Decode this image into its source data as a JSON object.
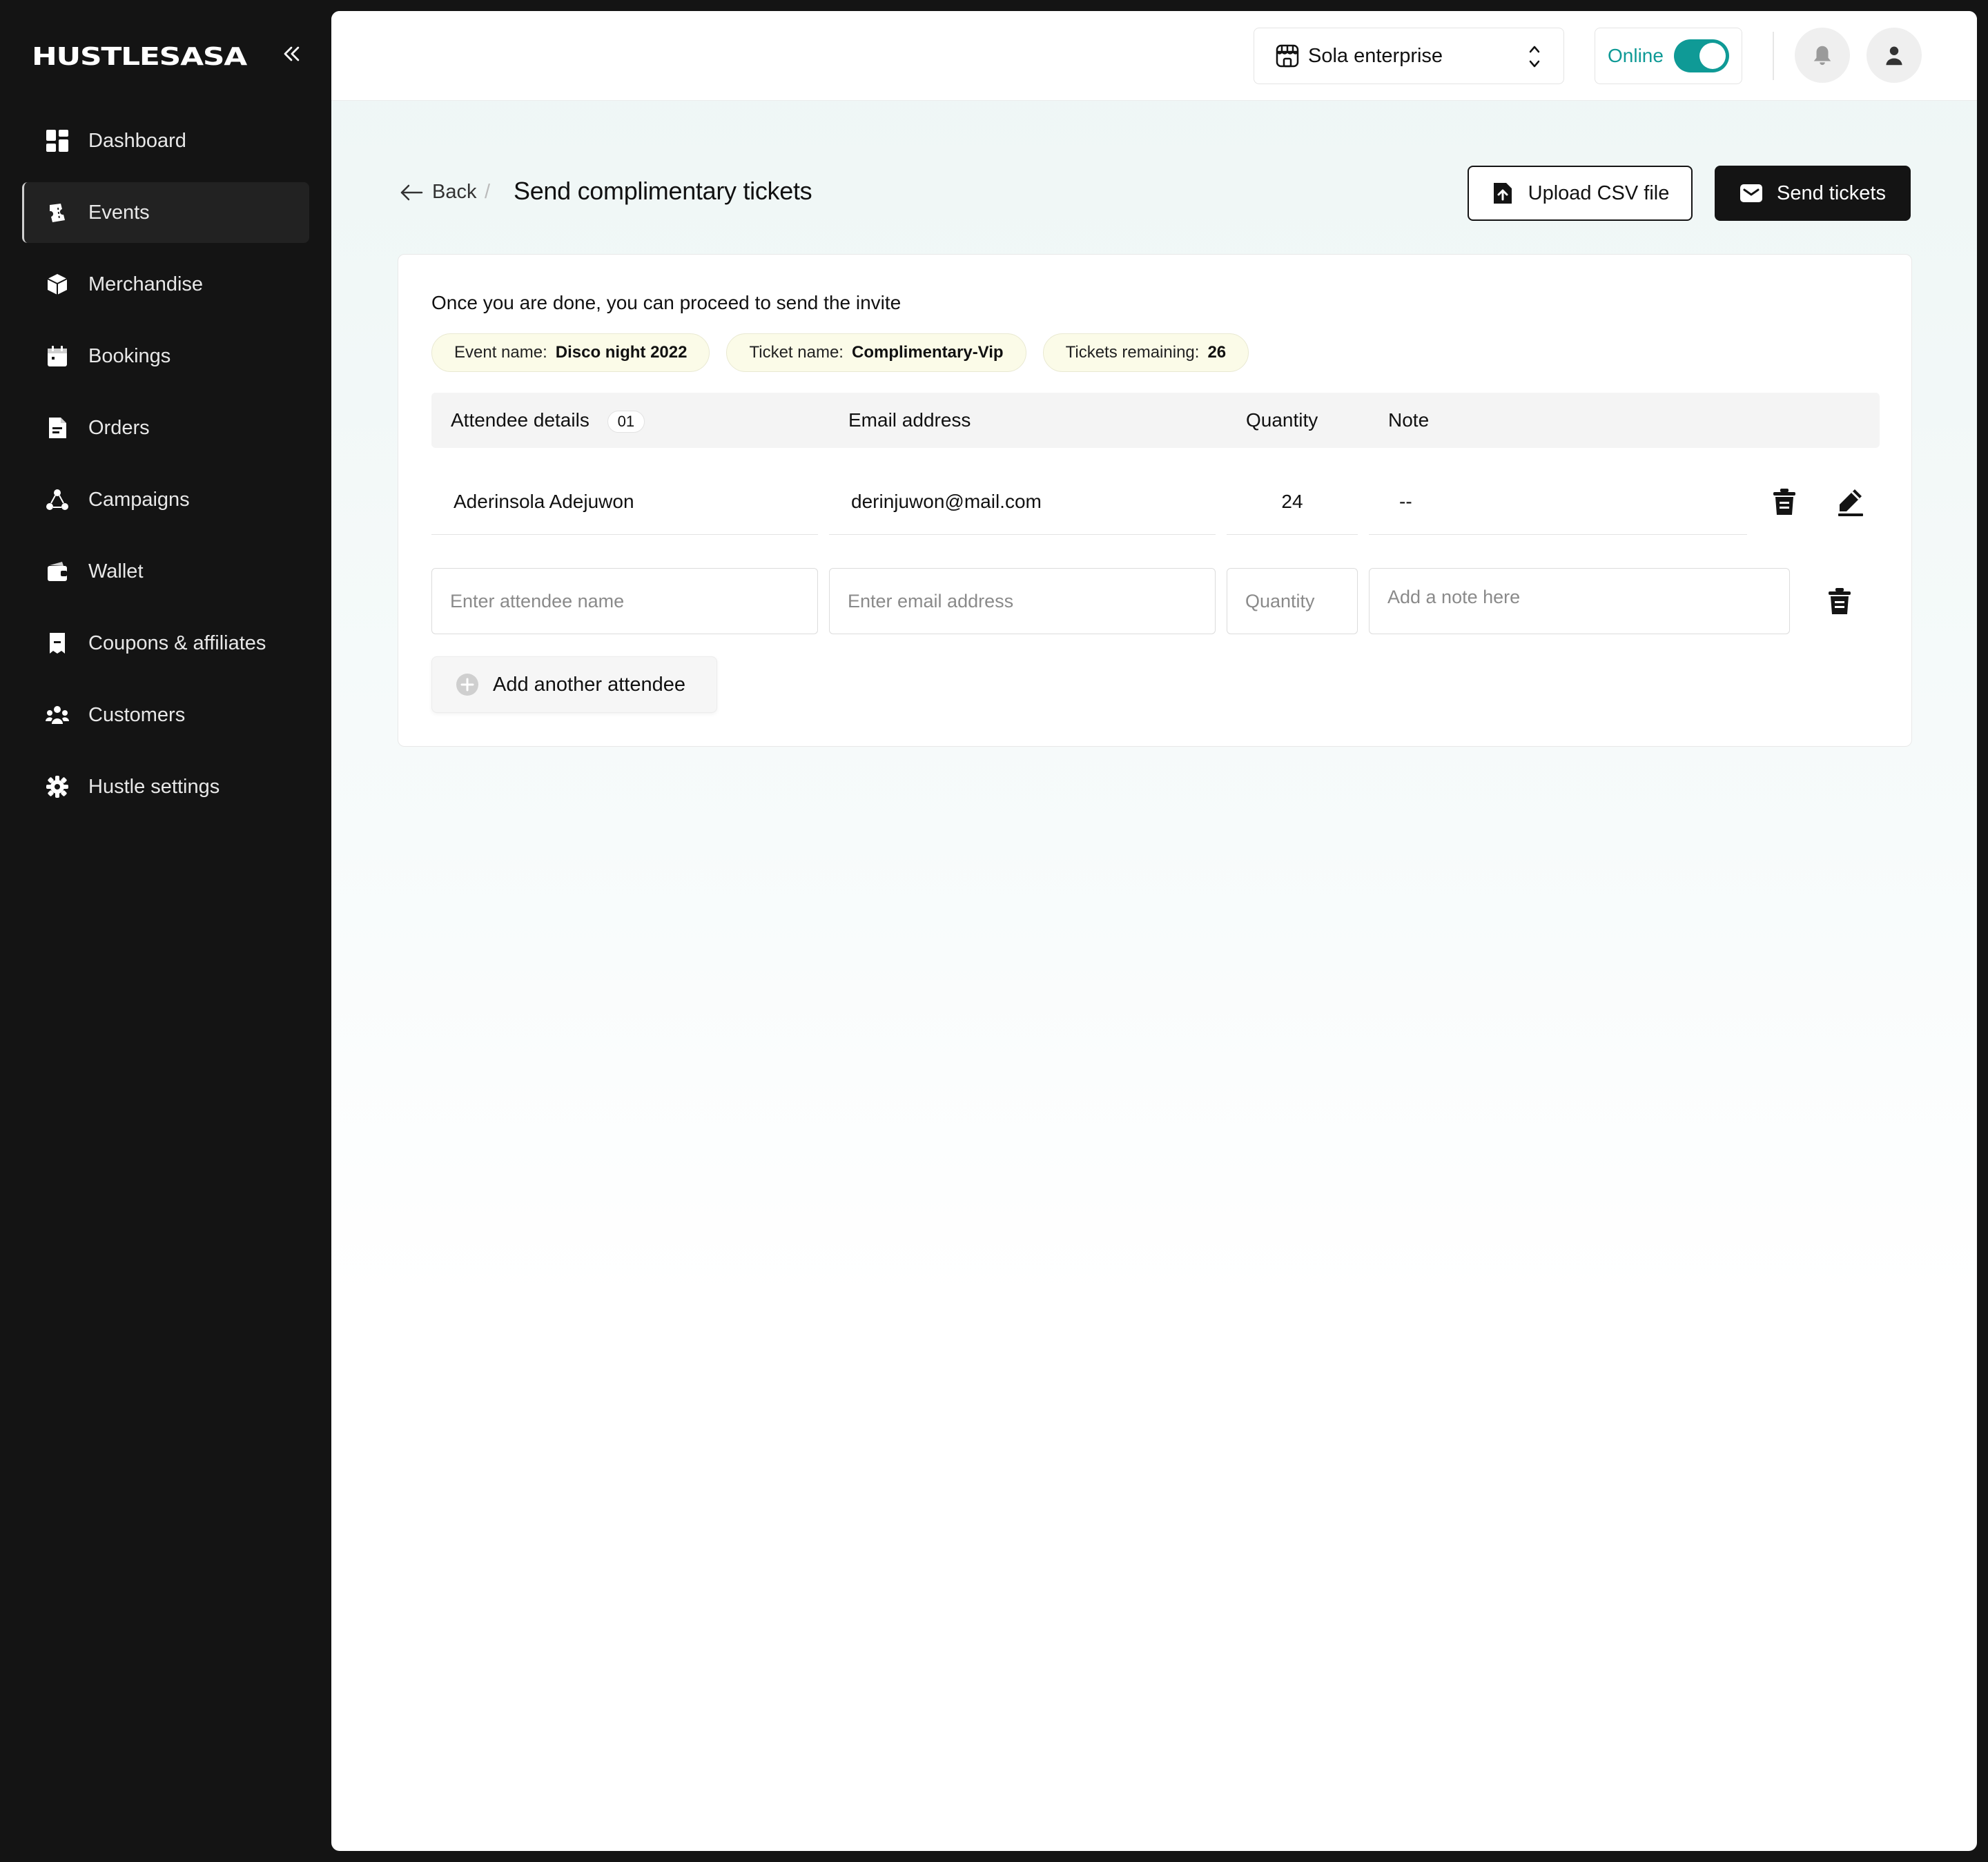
{
  "brand": {
    "logo_text": "HUSTLESASA"
  },
  "sidebar": {
    "items": [
      {
        "label": "Dashboard",
        "icon": "dashboard-icon"
      },
      {
        "label": "Events",
        "icon": "events-icon",
        "active": true
      },
      {
        "label": "Merchandise",
        "icon": "box-icon"
      },
      {
        "label": "Bookings",
        "icon": "calendar-icon"
      },
      {
        "label": "Orders",
        "icon": "orders-icon"
      },
      {
        "label": "Campaigns",
        "icon": "campaigns-icon"
      },
      {
        "label": "Wallet",
        "icon": "wallet-icon"
      },
      {
        "label": "Coupons & affiliates",
        "icon": "coupon-icon"
      },
      {
        "label": "Customers",
        "icon": "customers-icon"
      },
      {
        "label": "Hustle settings",
        "icon": "settings-gear-icon"
      }
    ]
  },
  "topbar": {
    "business_name": "Sola enterprise",
    "online_label": "Online",
    "online_enabled": true
  },
  "header": {
    "back_label": "Back",
    "separator": "/",
    "title": "Send complimentary tickets",
    "upload_label": "Upload CSV file",
    "send_label": "Send tickets"
  },
  "card": {
    "instruction": "Once you are done, you can proceed to send the invite",
    "chips": [
      {
        "label": "Event name:",
        "value": "Disco night 2022"
      },
      {
        "label": "Ticket name:",
        "value": "Complimentary-Vip"
      },
      {
        "label": "Tickets remaining:",
        "value": "26"
      }
    ],
    "columns": {
      "attendee": "Attendee details",
      "attendee_count": "01",
      "email": "Email address",
      "quantity": "Quantity",
      "note": "Note"
    },
    "rows": [
      {
        "name": "Aderinsola Adejuwon",
        "email": "derinjuwon@mail.com",
        "quantity": "24",
        "note": "--"
      }
    ],
    "new_row": {
      "name_placeholder": "Enter attendee name",
      "email_placeholder": "Enter email address",
      "quantity_placeholder": "Quantity",
      "note_placeholder": "Add a note here"
    },
    "add_label": "Add another attendee"
  },
  "colors": {
    "accent": "#0f9a96",
    "sidebar_bg": "#141414",
    "chip_bg": "#fbfbe8"
  }
}
